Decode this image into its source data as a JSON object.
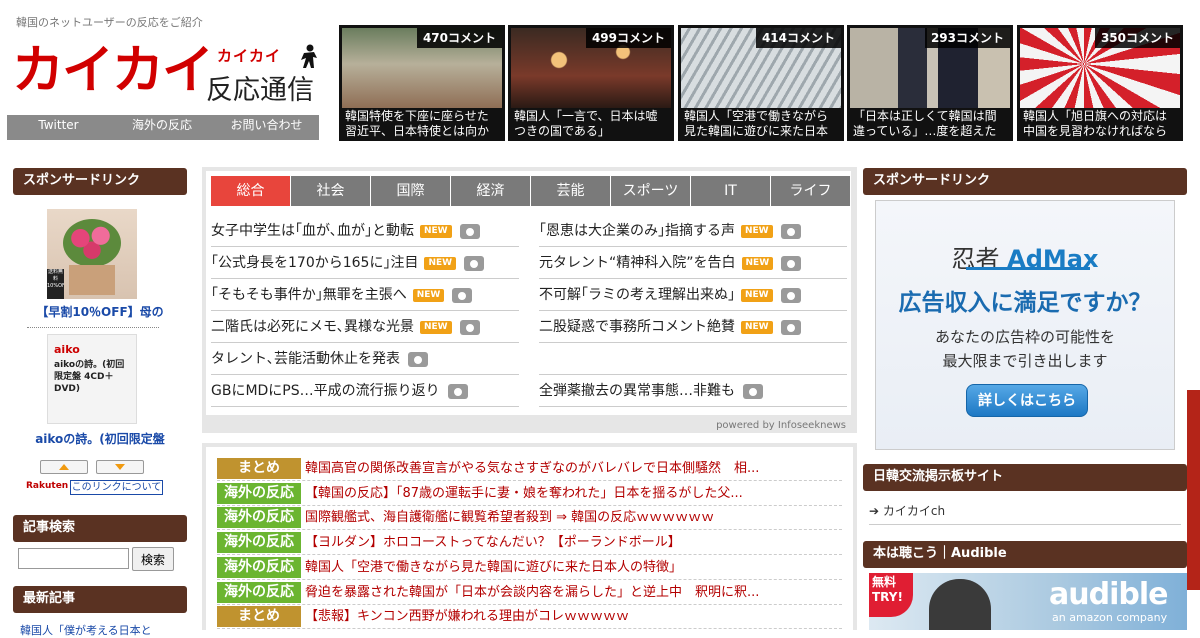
{
  "header": {
    "tagline": "韓国のネットユーザーの反応をご紹介",
    "logo_main": "カイカイ",
    "logo_ruby": "カイカイ",
    "logo_sub": "反応通信",
    "nav": [
      "Twitter",
      "海外の反応",
      "お問い合わせ"
    ]
  },
  "thumbs": [
    {
      "count": "470コメント",
      "caption": "韓国特使を下座に座らせた習近平、日本特使とは向かい合"
    },
    {
      "count": "499コメント",
      "caption": "韓国人「一言で、日本は嘘つきの国である」"
    },
    {
      "count": "414コメント",
      "caption": "韓国人「空港で働きながら見た韓国に遊びに来た日本人の"
    },
    {
      "count": "293コメント",
      "caption": "「日本は正しくて韓国は間違っている」…度を超えた日本"
    },
    {
      "count": "350コメント",
      "caption": "韓国人「旭日旗への対応は中国を見習わなければならな"
    }
  ],
  "left": {
    "sponsor_title": "スポンサードリンク",
    "product1_badge": "送料無料 10%OFF",
    "product1_title": "【早割10％OFF】母の",
    "product2_brand": "aiko",
    "product2_desc": "aikoの詩。(初回限定盤 4CD＋DVD)",
    "product2_title": "aikoの詩。(初回限定盤",
    "rakuten_label": "Rakuten",
    "link_about": "このリンクについて",
    "search_title": "記事検索",
    "search_button": "検索",
    "latest_title": "最新記事",
    "latest_item": "韓国人「僕が考える日本と"
  },
  "news": {
    "tabs": [
      "総合",
      "社会",
      "国際",
      "経済",
      "芸能",
      "スポーツ",
      "IT",
      "ライフ"
    ],
    "new_label": "NEW",
    "left_items": [
      {
        "text": "女子中学生は｢血が､血が｣と動転",
        "new": true
      },
      {
        "text": "｢公式身長を170から165に｣注目",
        "new": true
      },
      {
        "text": "｢そもそも事件か｣無罪を主張へ",
        "new": true
      },
      {
        "text": "二階氏は必死にメモ､異様な光景",
        "new": true
      },
      {
        "text": "タレント､芸能活動休止を発表",
        "new": false
      },
      {
        "text": "GBにMDにPS…平成の流行振り返り",
        "new": false
      }
    ],
    "right_items": [
      {
        "text": "｢恩恵は大企業のみ｣指摘する声",
        "new": true
      },
      {
        "text": "元タレント“精神科入院”を告白",
        "new": true
      },
      {
        "text": "不可解｢ラミの考え理解出来ぬ｣",
        "new": true
      },
      {
        "text": "二股疑惑で事務所コメント絶賛",
        "new": true
      },
      {
        "text": "",
        "new": false
      },
      {
        "text": "全弾薬撤去の異常事態…非難も",
        "new": false
      }
    ],
    "powered": "powered by Infoseeknews"
  },
  "feed": [
    {
      "cat": "まとめ",
      "title": "韓国高官の関係改善宣言がやる気なさすぎなのがバレバレで日本側騒然　相..."
    },
    {
      "cat": "海外の反応",
      "title": "【韓国の反応】「87歳の運転手に妻・娘を奪われた」日本を揺るがした父..."
    },
    {
      "cat": "海外の反応",
      "title": "国際観艦式、海自護衛艦に観覧希望者殺到 ⇒ 韓国の反応ｗｗｗｗｗｗ"
    },
    {
      "cat": "海外の反応",
      "title": "【ヨルダン】ホロコーストってなんだい？【ポーランドボール】"
    },
    {
      "cat": "海外の反応",
      "title": "韓国人「空港で働きながら見た韓国に遊びに来た日本人の特徴」"
    },
    {
      "cat": "海外の反応",
      "title": "脅迫を暴露された韓国が「日本が会談内容を漏らした」と逆上中　釈明に釈..."
    },
    {
      "cat": "まとめ",
      "title": "【悲報】キンコン西野が嫌われる理由がコレｗｗｗｗｗ"
    }
  ],
  "right": {
    "sponsor_title": "スポンサードリンク",
    "ad_brand_a": "忍者",
    "ad_brand_b": "AdMax",
    "ad_head": "広告収入に満足ですか？",
    "ad_body1": "あなたの広告枠の可能性を",
    "ad_body2": "最大限まで引き出します",
    "ad_button": "詳しくはこちら",
    "bbs_title": "日韓交流掲示板サイト",
    "bbs_link": "カイカイch",
    "audible_title": "本は聴こう｜Audible",
    "audible_free": "無料 TRY!",
    "audible_logo": "audible",
    "audible_sub": "an amazon company"
  },
  "colors": {
    "brand_red": "#d10000",
    "tab_active": "#e8453c",
    "side_head": "#5a3222",
    "cat_matome": "#c0932f",
    "cat_kaigai": "#6bb531"
  }
}
